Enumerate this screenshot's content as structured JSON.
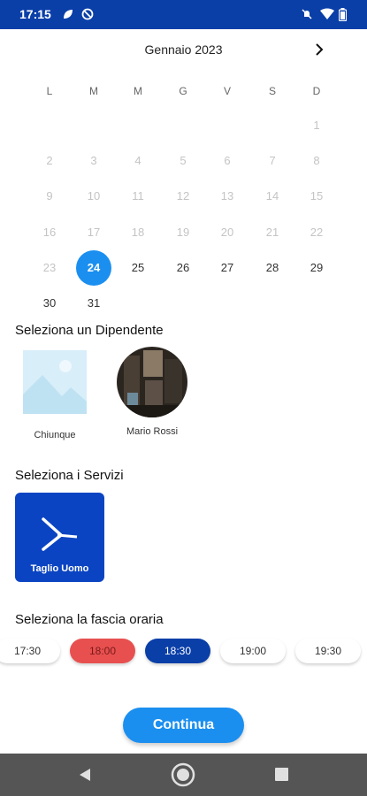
{
  "status_bar": {
    "time": "17:15",
    "icons_left": [
      "leaf-icon",
      "no-sync-icon"
    ],
    "icons_right": [
      "mute-icon",
      "wifi-icon",
      "battery-icon"
    ],
    "color": "#0a3fa8"
  },
  "calendar": {
    "month_label": "Gennaio 2023",
    "weekdays": [
      "L",
      "M",
      "M",
      "G",
      "V",
      "S",
      "D"
    ],
    "days": [
      {
        "label": "1",
        "state": "disabled"
      },
      {
        "label": "2",
        "state": "disabled"
      },
      {
        "label": "3",
        "state": "disabled"
      },
      {
        "label": "4",
        "state": "disabled"
      },
      {
        "label": "5",
        "state": "disabled"
      },
      {
        "label": "6",
        "state": "disabled"
      },
      {
        "label": "7",
        "state": "disabled"
      },
      {
        "label": "8",
        "state": "disabled"
      },
      {
        "label": "9",
        "state": "disabled"
      },
      {
        "label": "10",
        "state": "disabled"
      },
      {
        "label": "11",
        "state": "disabled"
      },
      {
        "label": "12",
        "state": "disabled"
      },
      {
        "label": "13",
        "state": "disabled"
      },
      {
        "label": "14",
        "state": "disabled"
      },
      {
        "label": "15",
        "state": "disabled"
      },
      {
        "label": "16",
        "state": "disabled"
      },
      {
        "label": "17",
        "state": "disabled"
      },
      {
        "label": "18",
        "state": "disabled"
      },
      {
        "label": "19",
        "state": "disabled"
      },
      {
        "label": "20",
        "state": "disabled"
      },
      {
        "label": "21",
        "state": "disabled"
      },
      {
        "label": "22",
        "state": "disabled"
      },
      {
        "label": "23",
        "state": "disabled"
      },
      {
        "label": "24",
        "state": "selected"
      },
      {
        "label": "25",
        "state": "enabled"
      },
      {
        "label": "26",
        "state": "enabled"
      },
      {
        "label": "27",
        "state": "enabled"
      },
      {
        "label": "28",
        "state": "enabled"
      },
      {
        "label": "29",
        "state": "enabled"
      },
      {
        "label": "30",
        "state": "enabled"
      },
      {
        "label": "31",
        "state": "enabled"
      }
    ]
  },
  "employees": {
    "title": "Seleziona un Dipendente",
    "items": [
      {
        "name": "Chiunque",
        "image": "placeholder-image-icon"
      },
      {
        "name": "Mario Rossi",
        "image": "avatar-photo"
      }
    ]
  },
  "services": {
    "title": "Seleziona i Servizi",
    "items": [
      {
        "label": "Taglio Uomo",
        "icon": "razor-icon"
      }
    ]
  },
  "time_slots": {
    "title": "Seleziona la fascia oraria",
    "items": [
      {
        "label": "17:30",
        "state": "available"
      },
      {
        "label": "18:00",
        "state": "busy"
      },
      {
        "label": "18:30",
        "state": "selected"
      },
      {
        "label": "19:00",
        "state": "available"
      },
      {
        "label": "19:30",
        "state": "available"
      }
    ]
  },
  "actions": {
    "continue_label": "Continua"
  },
  "nav_bar": {
    "icons": [
      "back-icon",
      "home-icon",
      "recents-icon"
    ]
  },
  "colors": {
    "primary_blue": "#0a3fa8",
    "accent_blue": "#1a8ff0",
    "busy_red": "#e85050",
    "service_blue": "#0b44c2"
  }
}
